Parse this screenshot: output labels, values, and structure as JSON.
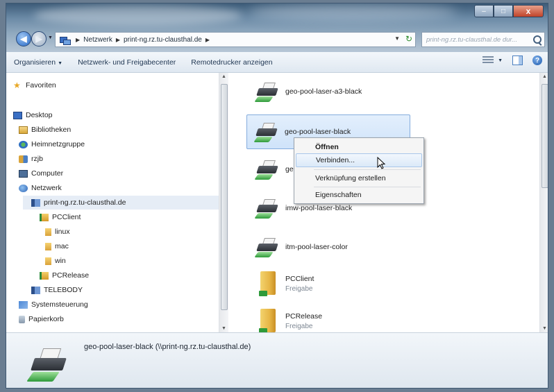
{
  "window": {
    "controls": {
      "minimize": "–",
      "maximize": "□",
      "close": "x"
    }
  },
  "address": {
    "crumbs": [
      "Netzwerk",
      "print-ng.rz.tu-clausthal.de"
    ],
    "search_placeholder": "print-ng.rz.tu-clausthal.de dur..."
  },
  "commandbar": {
    "organize": "Organisieren",
    "network_center": "Netzwerk- und Freigabecenter",
    "remote_printers": "Remotedrucker anzeigen"
  },
  "navpane": {
    "favorites": "Favoriten",
    "desktop": "Desktop",
    "libraries": "Bibliotheken",
    "homegroup": "Heimnetzgruppe",
    "user": "rzjb",
    "computer": "Computer",
    "network": "Netzwerk",
    "server": "print-ng.rz.tu-clausthal.de",
    "pcclient": "PCClient",
    "linux": "linux",
    "mac": "mac",
    "win": "win",
    "pcrelease": "PCRelease",
    "telebody": "TELEBODY",
    "control_panel": "Systemsteuerung",
    "recycle_bin": "Papierkorb"
  },
  "files": [
    {
      "name": "geo-pool-laser-a3-black",
      "type": "printer"
    },
    {
      "name": "geo-pool-laser-black",
      "type": "printer"
    },
    {
      "name": "geo",
      "type": "printer"
    },
    {
      "name": "imw-pool-laser-black",
      "type": "printer"
    },
    {
      "name": "itm-pool-laser-color",
      "type": "printer"
    },
    {
      "name": "PCClient",
      "sub": "Freigabe",
      "type": "share"
    },
    {
      "name": "PCRelease",
      "sub": "Freigabe",
      "type": "share"
    }
  ],
  "context_menu": {
    "open": "Öffnen",
    "connect": "Verbinden...",
    "shortcut": "Verknüpfung erstellen",
    "properties": "Eigenschaften"
  },
  "details": {
    "title": "geo-pool-laser-black (\\\\print-ng.rz.tu-clausthal.de)"
  }
}
